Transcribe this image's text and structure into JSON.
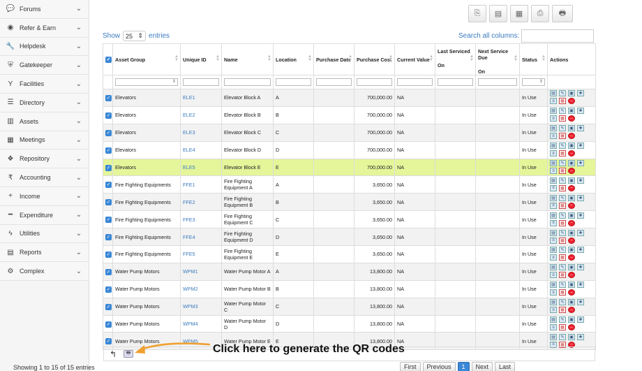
{
  "sidebar": {
    "items": [
      {
        "label": "Forums",
        "icon": "chat-icon"
      },
      {
        "label": "Refer & Earn",
        "icon": "eye-icon"
      },
      {
        "label": "Helpdesk",
        "icon": "wrench-icon"
      },
      {
        "label": "Gatekeeper",
        "icon": "shield-icon"
      },
      {
        "label": "Facilities",
        "icon": "cocktail-icon"
      },
      {
        "label": "Directory",
        "icon": "list-icon"
      },
      {
        "label": "Assets",
        "icon": "building-icon"
      },
      {
        "label": "Meetings",
        "icon": "calendar-icon"
      },
      {
        "label": "Repository",
        "icon": "dropbox-icon"
      },
      {
        "label": "Accounting",
        "icon": "rupee-icon"
      },
      {
        "label": "Income",
        "icon": "plus-icon"
      },
      {
        "label": "Expenditure",
        "icon": "minus-icon"
      },
      {
        "label": "Utilities",
        "icon": "bolt-icon"
      },
      {
        "label": "Reports",
        "icon": "report-icon"
      },
      {
        "label": "Complex",
        "icon": "gear-icon"
      }
    ]
  },
  "controls": {
    "show_label": "Show",
    "entries_value": "25",
    "entries_label": "entries",
    "search_label": "Search all columns:",
    "search_value": ""
  },
  "columns": [
    "Asset Group",
    "Unique ID",
    "Name",
    "Location",
    "Purchase Date",
    "Purchase Cost",
    "Current Value",
    "Last Serviced",
    "Next Service Due",
    "Status",
    "Actions"
  ],
  "column_second_line": {
    "last_serviced": "On",
    "next_service_due": "On"
  },
  "rows": [
    {
      "group": "Elevators",
      "id": "ELE1",
      "name": "Elevator Block A",
      "location": "A",
      "date": "",
      "cost": "700,000.00",
      "value": "NA",
      "last": "",
      "next": "",
      "status": "In Use"
    },
    {
      "group": "Elevators",
      "id": "ELE2",
      "name": "Elevator Block B",
      "location": "B",
      "date": "",
      "cost": "700,000.00",
      "value": "NA",
      "last": "",
      "next": "",
      "status": "In Use"
    },
    {
      "group": "Elevators",
      "id": "ELE3",
      "name": "Elevator Block C",
      "location": "C",
      "date": "",
      "cost": "700,000.00",
      "value": "NA",
      "last": "",
      "next": "",
      "status": "In Use"
    },
    {
      "group": "Elevators",
      "id": "ELE4",
      "name": "Elevator Block D",
      "location": "D",
      "date": "",
      "cost": "700,000.00",
      "value": "NA",
      "last": "",
      "next": "",
      "status": "In Use"
    },
    {
      "group": "Elevators",
      "id": "ELE5",
      "name": "Elevator Block E",
      "location": "E",
      "date": "",
      "cost": "700,000.00",
      "value": "NA",
      "last": "",
      "next": "",
      "status": "In Use"
    },
    {
      "group": "Fire Fighting Equipments",
      "id": "FFE1",
      "name": "Fire Fighting Equipment A",
      "location": "A",
      "date": "",
      "cost": "3,650.00",
      "value": "NA",
      "last": "",
      "next": "",
      "status": "In Use"
    },
    {
      "group": "Fire Fighting Equipments",
      "id": "FFE2",
      "name": "Fire Fighting Equipment B",
      "location": "B",
      "date": "",
      "cost": "3,650.00",
      "value": "NA",
      "last": "",
      "next": "",
      "status": "In Use"
    },
    {
      "group": "Fire Fighting Equipments",
      "id": "FFE3",
      "name": "Fire Fighting Equipment C",
      "location": "C",
      "date": "",
      "cost": "3,650.00",
      "value": "NA",
      "last": "",
      "next": "",
      "status": "In Use"
    },
    {
      "group": "Fire Fighting Equipments",
      "id": "FFE4",
      "name": "Fire Fighting Equipment D",
      "location": "D",
      "date": "",
      "cost": "3,650.00",
      "value": "NA",
      "last": "",
      "next": "",
      "status": "In Use"
    },
    {
      "group": "Fire Fighting Equipments",
      "id": "FFE5",
      "name": "Fire Fighting Equipment E",
      "location": "E",
      "date": "",
      "cost": "3,650.00",
      "value": "NA",
      "last": "",
      "next": "",
      "status": "In Use"
    },
    {
      "group": "Water Pump Motors",
      "id": "WPM1",
      "name": "Water Pump Motor A",
      "location": "A",
      "date": "",
      "cost": "13,800.00",
      "value": "NA",
      "last": "",
      "next": "",
      "status": "In Use"
    },
    {
      "group": "Water Pump Motors",
      "id": "WPM2",
      "name": "Water Pump Motor B",
      "location": "B",
      "date": "",
      "cost": "13,800.00",
      "value": "NA",
      "last": "",
      "next": "",
      "status": "In Use"
    },
    {
      "group": "Water Pump Motors",
      "id": "WPM3",
      "name": "Water Pump Motor C",
      "location": "C",
      "date": "",
      "cost": "13,800.00",
      "value": "NA",
      "last": "",
      "next": "",
      "status": "In Use"
    },
    {
      "group": "Water Pump Motors",
      "id": "WPM4",
      "name": "Water Pump Motor D",
      "location": "D",
      "date": "",
      "cost": "13,800.00",
      "value": "NA",
      "last": "",
      "next": "",
      "status": "In Use"
    },
    {
      "group": "Water Pump Motors",
      "id": "WPM5",
      "name": "Water Pump Motor E",
      "location": "E",
      "date": "",
      "cost": "13,800.00",
      "value": "NA",
      "last": "",
      "next": "",
      "status": "In Use"
    }
  ],
  "highlighted_row": 4,
  "annotation": "Click here to generate the QR codes",
  "footer": {
    "info": "Showing 1 to 15 of 15 entries",
    "pager": [
      "First",
      "Previous",
      "1",
      "Next",
      "Last"
    ],
    "active_page": "1"
  },
  "colors": {
    "accent": "#3a87d6",
    "highlight": "#e5f59a",
    "annotation_arrow": "#f0a030",
    "link": "#3a7bbf"
  }
}
